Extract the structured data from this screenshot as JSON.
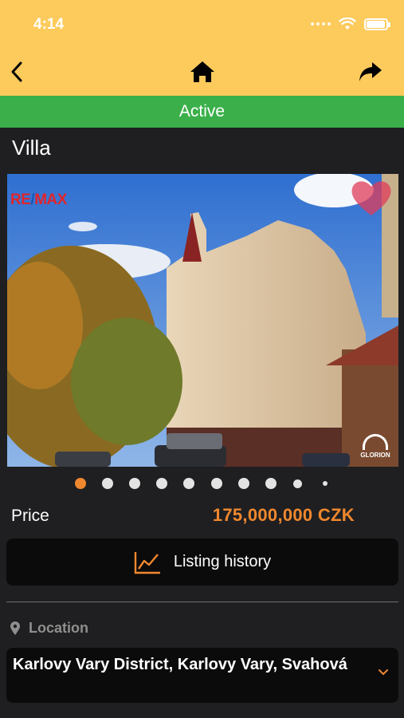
{
  "status_bar": {
    "time": "4:14"
  },
  "nav": {
    "back_icon": "chevron-left-icon",
    "home_icon": "home-icon",
    "share_icon": "share-arrow-icon"
  },
  "banner": {
    "label": "Active",
    "color": "#3bb04a"
  },
  "listing": {
    "title": "Villa",
    "photo": {
      "watermark_left": "RE/MAX",
      "watermark_right": "GLORION",
      "current_index": 1,
      "count": 10
    },
    "price_label": "Price",
    "price_value": "175,000,000 CZK",
    "history_button": "Listing history",
    "location_label": "Location",
    "location_value": "Karlovy Vary District, Karlovy Vary, Svahová"
  },
  "colors": {
    "header": "#fdca5c",
    "accent": "#f0882e",
    "background": "#1f1f21",
    "card": "#0b0b0b"
  }
}
